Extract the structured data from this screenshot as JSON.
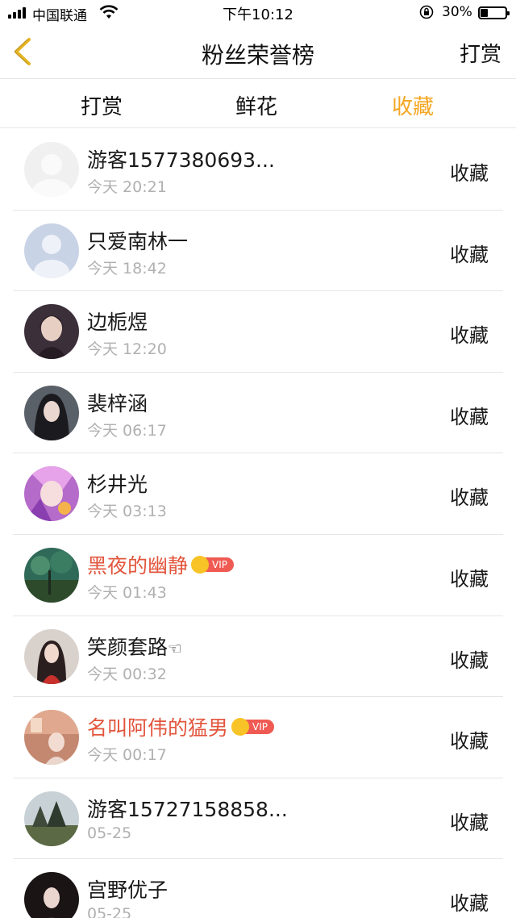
{
  "status_bar": {
    "carrier": "中国联通",
    "time": "下午10:12",
    "battery": "30%",
    "battery_level": 0.3
  },
  "nav": {
    "title": "粉丝荣誉榜",
    "right_action": "打赏"
  },
  "tabs": [
    {
      "label": "打赏",
      "active": false
    },
    {
      "label": "鲜花",
      "active": false
    },
    {
      "label": "收藏",
      "active": true
    }
  ],
  "colors": {
    "accent": "#f5a623",
    "vip_name": "#e2553c",
    "vip_badge": "#ef5a53",
    "crown": "#f7c326"
  },
  "vip_badge_text": "VIP",
  "list": [
    {
      "name": "游客1577380693...",
      "time": "今天 20:21",
      "action": "收藏",
      "vip": false
    },
    {
      "name": "只爱南林一",
      "time": "今天 18:42",
      "action": "收藏",
      "vip": false
    },
    {
      "name": "边栀煜",
      "time": "今天 12:20",
      "action": "收藏",
      "vip": false
    },
    {
      "name": "裴梓涵",
      "time": "今天 06:17",
      "action": "收藏",
      "vip": false
    },
    {
      "name": "杉井光",
      "time": "今天 03:13",
      "action": "收藏",
      "vip": false
    },
    {
      "name": "黑夜的幽静",
      "time": "今天 01:43",
      "action": "收藏",
      "vip": true
    },
    {
      "name": "笑颜套路",
      "emoji": "☜",
      "time": "今天 00:32",
      "action": "收藏",
      "vip": false
    },
    {
      "name": "名叫阿伟的猛男",
      "time": "今天 00:17",
      "action": "收藏",
      "vip": true
    },
    {
      "name": "游客15727158858...",
      "time": "05-25",
      "action": "收藏",
      "vip": false
    },
    {
      "name": "宫野优子",
      "time": "05-25",
      "action": "收藏",
      "vip": false
    }
  ]
}
